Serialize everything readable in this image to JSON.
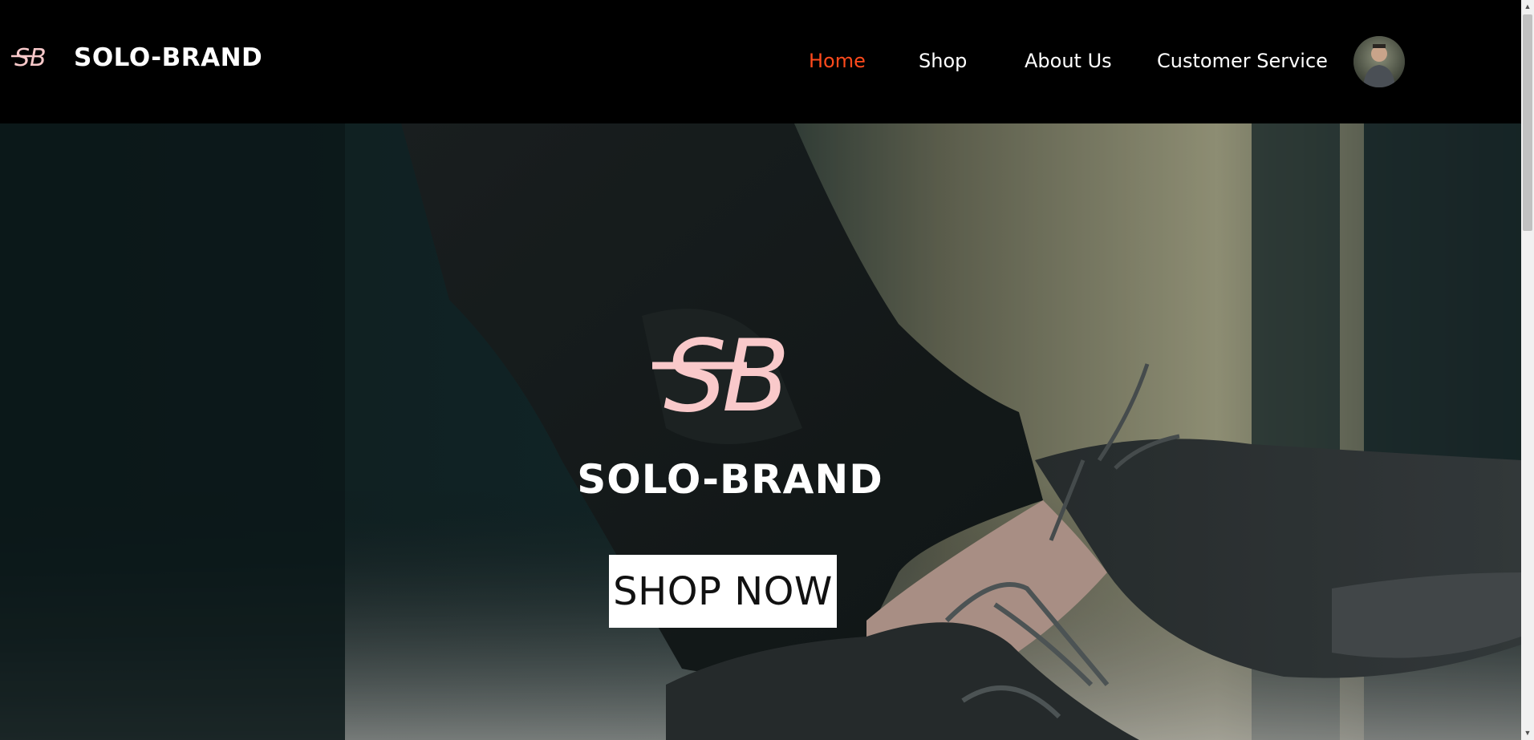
{
  "header": {
    "brand_name": "SOLO-BRAND",
    "logo_icon": "sb-monogram-icon",
    "nav": [
      {
        "label": "Home",
        "active": true
      },
      {
        "label": "Shop",
        "active": false
      },
      {
        "label": "About Us",
        "active": false
      },
      {
        "label": "Customer Service",
        "active": false
      }
    ],
    "avatar_icon": "user-avatar-icon"
  },
  "hero": {
    "title": "SOLO-BRAND",
    "cta_label": "SHOP NOW",
    "logo_icon": "sb-monogram-icon"
  },
  "colors": {
    "header_bg": "#000000",
    "nav_active": "#ff4a1c",
    "nav_text": "#ffffff",
    "logo_pink": "#f9c9ca",
    "hero_overlay": "#0f2023"
  }
}
